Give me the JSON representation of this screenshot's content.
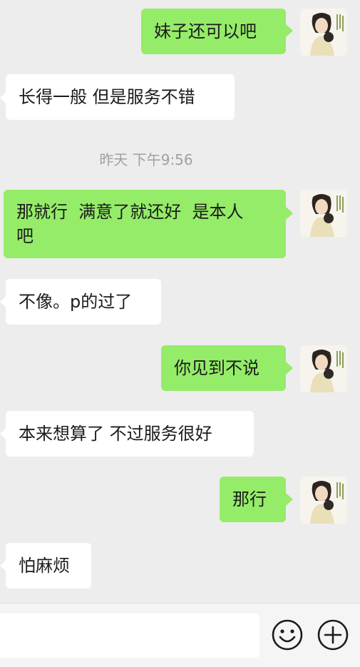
{
  "messages": [
    {
      "side": "me",
      "text": "妹子还可以吧"
    },
    {
      "side": "other",
      "text": "长得一般 但是服务不错"
    },
    {
      "side": "me",
      "text": "那就行  满意了就还好  是本人\n吧"
    },
    {
      "side": "other",
      "text": "不像。p的过了"
    },
    {
      "side": "me",
      "text": "你见到不说"
    },
    {
      "side": "other",
      "text": "本来想算了 不过服务很好"
    },
    {
      "side": "me",
      "text": "那行"
    },
    {
      "side": "other",
      "text": "怕麻烦"
    }
  ],
  "timestamp": "昨天 下午9:56",
  "colors": {
    "me_bubble": "#95ec69",
    "other_bubble": "#ffffff",
    "background": "#ededed"
  },
  "input_bar": {
    "icons": [
      "emoji-icon",
      "plus-icon"
    ]
  }
}
